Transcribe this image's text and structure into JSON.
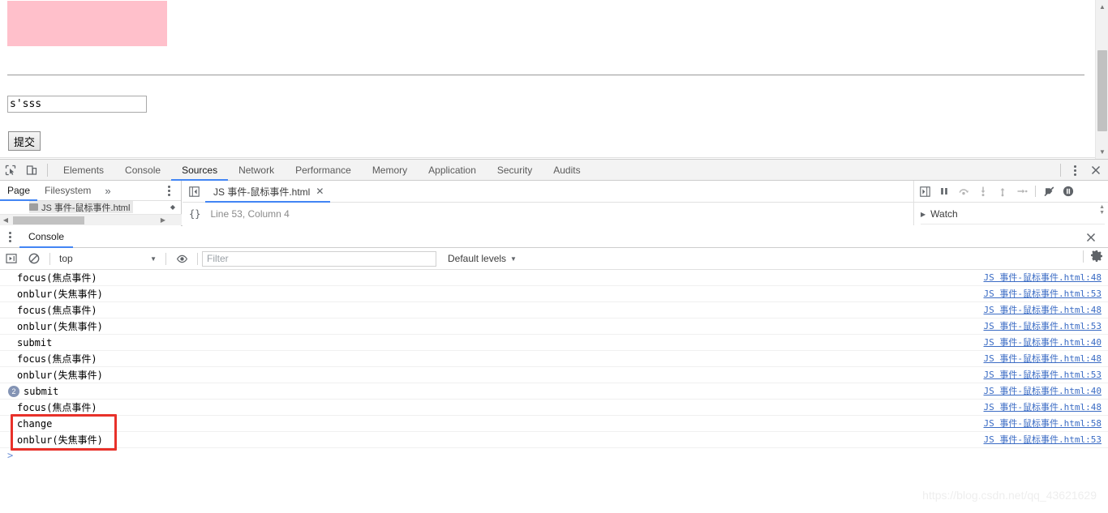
{
  "page": {
    "pink_box_color": "#FFC0CB",
    "input_value": "s'sss",
    "input_placeholder": "",
    "submit_label": "提交"
  },
  "devtools": {
    "toolbar": {
      "inspect_icon": "inspect-cursor-icon",
      "device_icon": "device-toolbar-icon",
      "tabs": [
        {
          "label": "Elements",
          "active": false
        },
        {
          "label": "Console",
          "active": false
        },
        {
          "label": "Sources",
          "active": true
        },
        {
          "label": "Network",
          "active": false
        },
        {
          "label": "Performance",
          "active": false
        },
        {
          "label": "Memory",
          "active": false
        },
        {
          "label": "Application",
          "active": false
        },
        {
          "label": "Security",
          "active": false
        },
        {
          "label": "Audits",
          "active": false
        }
      ],
      "more_label": "⋮",
      "close_label": "✕"
    },
    "navigator": {
      "tabs": [
        {
          "label": "Page",
          "active": true
        },
        {
          "label": "Filesystem",
          "active": false
        }
      ],
      "overflow_label": "»",
      "tree_file": "JS 事件-鼠标事件.html"
    },
    "editor": {
      "tab_label": "JS 事件-鼠标事件.html",
      "tab_close": "✕",
      "format_icon": "{}",
      "cursor_position": "Line 53, Column 4"
    },
    "debugger": {
      "buttons": [
        "pause-script-icon",
        "step-over-icon",
        "step-into-icon",
        "step-out-icon",
        "step-icon",
        "deactivate-breakpoints-icon",
        "pause-on-exceptions-icon"
      ],
      "watch_label": "Watch"
    },
    "drawer": {
      "tab_label": "Console",
      "close_label": "✕",
      "toolbar": {
        "execute_icon": "execution-context-icon",
        "clear_icon": "clear-console-icon",
        "context_value": "top",
        "eye_icon": "live-expression-icon",
        "filter_placeholder": "Filter",
        "filter_value": "",
        "levels_label": "Default levels",
        "settings_icon": "gear-icon"
      },
      "messages": [
        {
          "text": "focus(焦点事件)",
          "count": null,
          "source": "JS 事件-鼠标事件.html:48"
        },
        {
          "text": "onblur(失焦事件)",
          "count": null,
          "source": "JS 事件-鼠标事件.html:53"
        },
        {
          "text": "focus(焦点事件)",
          "count": null,
          "source": "JS 事件-鼠标事件.html:48"
        },
        {
          "text": "onblur(失焦事件)",
          "count": null,
          "source": "JS 事件-鼠标事件.html:53"
        },
        {
          "text": "submit",
          "count": null,
          "source": "JS 事件-鼠标事件.html:40"
        },
        {
          "text": "focus(焦点事件)",
          "count": null,
          "source": "JS 事件-鼠标事件.html:48"
        },
        {
          "text": "onblur(失焦事件)",
          "count": null,
          "source": "JS 事件-鼠标事件.html:53"
        },
        {
          "text": "submit",
          "count": "2",
          "source": "JS 事件-鼠标事件.html:40"
        },
        {
          "text": "focus(焦点事件)",
          "count": null,
          "source": "JS 事件-鼠标事件.html:48"
        },
        {
          "text": "change",
          "count": null,
          "source": "JS 事件-鼠标事件.html:58"
        },
        {
          "text": "onblur(失焦事件)",
          "count": null,
          "source": "JS 事件-鼠标事件.html:53"
        }
      ],
      "prompt_symbol": ">"
    }
  },
  "annotation": {
    "color": "#E8312A"
  },
  "watermark": "https://blog.csdn.net/qq_43621629"
}
